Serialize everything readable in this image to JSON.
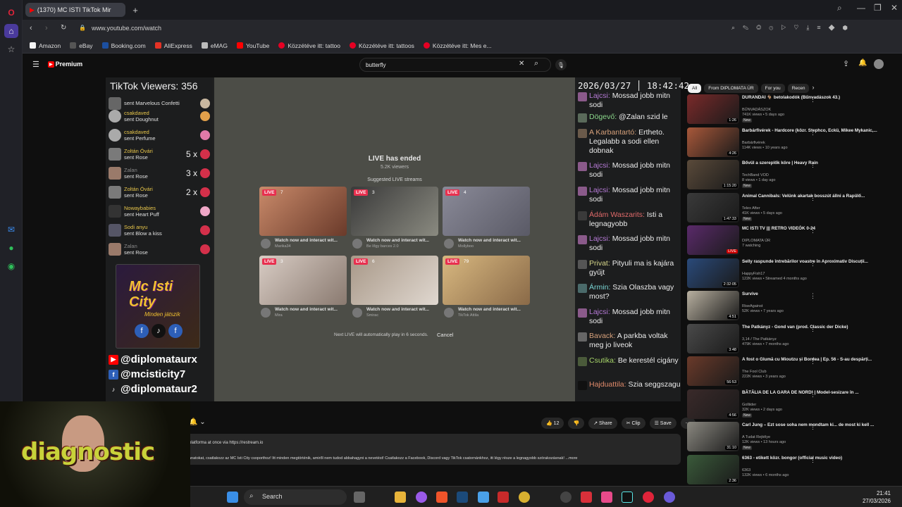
{
  "browser": {
    "tab_title": "(1370) MC ISTI TikTok Mir",
    "url": "www.youtube.com/watch",
    "bookmarks": [
      "Amazon",
      "eBay",
      "Booking.com",
      "AliExpress",
      "eMAG",
      "YouTube",
      "Közzétéve itt: tattoo",
      "Közzétéve itt: tattoos",
      "Közzétéve itt: Mes e..."
    ]
  },
  "youtube": {
    "logo": "Premium",
    "search_value": "butterfly"
  },
  "stream": {
    "viewers": "TikTok Viewers: 356",
    "clock": "2026/03/27 │ 18:42:42",
    "gifts": [
      {
        "who": "",
        "what": "sent Marvelous Confetti",
        "mult": ""
      },
      {
        "who": "csakdaved",
        "what": "sent Doughnut",
        "mult": ""
      },
      {
        "who": "csakdaved",
        "what": "sent Perfume",
        "mult": ""
      },
      {
        "who": "Zoltán Óvári",
        "what": "sent Rose",
        "mult": "5 x"
      },
      {
        "who": "Zalan",
        "what": "sent Rose",
        "mult": "3 x"
      },
      {
        "who": "Zoltán Óvári",
        "what": "sent Rose",
        "mult": "2 x"
      },
      {
        "who": "Nowaybabies",
        "what": "sent Heart Puff",
        "mult": ""
      },
      {
        "who": "Sodi anyu",
        "what": "sent Blow a kiss",
        "mult": ""
      },
      {
        "who": "Zalan",
        "what": "sent Rose",
        "mult": ""
      }
    ],
    "logo_title": "Mc Isti City",
    "logo_sub": "Minden játszik",
    "socials": [
      "@diplomataurx",
      "@mcisticity7",
      "@diplomataur2"
    ],
    "ended_title": "LIVE has ended",
    "ended_viewers": "5.2K viewers",
    "suggested": "Suggested LIVE streams",
    "cards": [
      {
        "count": "7",
        "cap": "Watch now and interact wit...",
        "sub": "Marika34"
      },
      {
        "count": "3",
        "cap": "Watch now and interact wit...",
        "sub": "Be lőgy barces 2.0"
      },
      {
        "count": "4",
        "cap": "Watch now and interact wit...",
        "sub": "Mollyboo"
      },
      {
        "count": "3",
        "cap": "Watch now and interact wit...",
        "sub": "Mira"
      },
      {
        "count": "6",
        "cap": "Watch now and interact wit...",
        "sub": "Smirac"
      },
      {
        "count": "79",
        "cap": "Watch now and interact wit...",
        "sub": "TikTok Attila"
      }
    ],
    "live_label": "LIVE",
    "next_live": "Next LIVE will automatically play in 6 seconds.",
    "cancel": "Cancel",
    "chat": [
      {
        "name": "Lajcsi:",
        "text": "Mossad jobb mitn sodi"
      },
      {
        "name": "Dögevő:",
        "text": "@Zalan szid le"
      },
      {
        "name": "A Karbantartó:",
        "text": "Ertheto. Legalabb a sodi ellen dobnak"
      },
      {
        "name": "Lajcsi:",
        "text": "Mossad jobb mitn sodi"
      },
      {
        "name": "Lajcsi:",
        "text": "Mossad jobb mitn sodi"
      },
      {
        "name": "Ádám Waszarits:",
        "text": "Isti a legnagyobb"
      },
      {
        "name": "Lajcsi:",
        "text": "Mossad jobb mitn sodi"
      },
      {
        "name": "Privat:",
        "text": "Pityuli ma is kajára gyűjt"
      },
      {
        "name": "Ármin:",
        "text": "Szia Olaszba vagy most?"
      },
      {
        "name": "Lajcsi:",
        "text": "Mossad jobb mitn sodi"
      },
      {
        "name": "Bavack:",
        "text": "A parkba voltak meg jo liveok"
      },
      {
        "name": "Csutika:",
        "text": "Be kerestél cigány"
      },
      {
        "name": "Hajduattila:",
        "text": "Szia seggszagu"
      }
    ]
  },
  "actions": {
    "likes": "12",
    "share": "Share",
    "clip": "Clip",
    "save": "Save"
  },
  "description": {
    "line1": "platforma at once via https://restream.io",
    "line2": "anatokat, csatlakozz az MC Isti City csoporthoz! Itt minden megtörténik, amiről nem tudod abbahagyni a nevetést! Csatlakozz a Facebook, Discord vagy TikTok csatornánkhoz, itt légy része a legnagyobb szórakozásnak! ...more"
  },
  "recs": {
    "chips": [
      "All",
      "From DIPLOMATA ÚR",
      "For you",
      "Recen"
    ],
    "items": [
      {
        "title": "DURANDAI 🐐 betolakodók (Bűnvadászok 43.)",
        "ch": "BŰNVADÁSZOK",
        "meta": "741K views • 5 days ago",
        "dur": "1:26",
        "badge": "New"
      },
      {
        "title": "Barbárfivérek - Hardcore (közr. Stephco, Eckü, Mikee Mykanic,...",
        "ch": "Barbárfivérek",
        "meta": "114K views • 10 years ago",
        "dur": "4:26",
        "badge": ""
      },
      {
        "title": "Bővül a szereplők köre | Heavy Rain",
        "ch": "TechBand VOD",
        "meta": "8 views • 1 day ago",
        "dur": "1:15:20",
        "badge": "New"
      },
      {
        "title": "Animal Cannibals: Velünk akartak bosszút állni a Rapülő...",
        "ch": "Telex After",
        "meta": "41K views • 5 days ago",
        "dur": "1:47:33",
        "badge": "New"
      },
      {
        "title": "MC ISTI TV ||| RETRO VIDEÓK 0-24",
        "ch": "DIPLOMATA ÚR",
        "meta": "7 watching",
        "dur": "LIVE",
        "badge": ""
      },
      {
        "title": "Selly raspunde întrebărilor voastre în Aproximativ Discuții...",
        "ch": "HappyFish17",
        "meta": "122K views • Streamed 4 months ago",
        "dur": "2:32:05",
        "badge": ""
      },
      {
        "title": "Survive",
        "ch": "RiseAgainst",
        "meta": "52K views • 7 years ago",
        "dur": "4:51",
        "badge": ""
      },
      {
        "title": "The Patkányz - Gond van (prod. Classic der Dicke)",
        "ch": "3,14 / The Patkányz",
        "meta": "479K views • 7 months ago",
        "dur": "3:48",
        "badge": ""
      },
      {
        "title": "A fost o Glumă cu Mioutzu și Bordea | Ep. 56 - S-au despărți...",
        "ch": "The Fool Club",
        "meta": "222K views • 3 years ago",
        "dur": "56:53",
        "badge": ""
      },
      {
        "title": "BĂTĂLIA DE LA GARA DE NORD! | Model-sesizare în ...",
        "ch": "Golliider",
        "meta": "32K views • 2 days ago",
        "dur": "4:56",
        "badge": "New"
      },
      {
        "title": "Carl Jung – Ezt sose soha nem mondtam ki... de most ki kell ...",
        "ch": "A Tudat Rejtélye",
        "meta": "12K views • 13 hours ago",
        "dur": "31:10",
        "badge": "New"
      },
      {
        "title": "6363 - etikett közr. bongor (official music video)",
        "ch": "6363",
        "meta": "132K views • 6 months ago",
        "dur": "2:36",
        "badge": ""
      }
    ]
  },
  "webcam": {
    "text": "diagnostic"
  },
  "taskbar": {
    "search": "Search",
    "time": "21:41",
    "date": "27/03/2026"
  },
  "colors": {
    "chat_name": "#b67ad6",
    "gift_name": "#e8c64a",
    "live": "#e8304f"
  }
}
